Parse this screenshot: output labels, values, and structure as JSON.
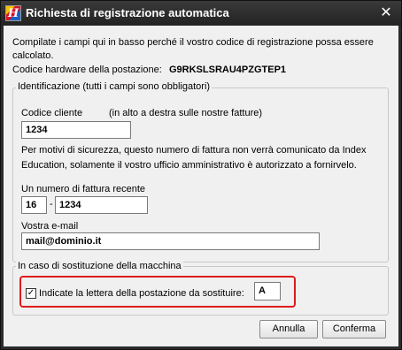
{
  "window": {
    "title": "Richiesta di registrazione automatica",
    "close_glyph": "✕",
    "app_icon_letter": "H"
  },
  "intro": {
    "text": "Compilate i campi qui in basso perché il vostro codice di registrazione possa essere calcolato.",
    "hardware_label": "Codice hardware della postazione:",
    "hardware_code": "G9RKSLSRAU4PZGTEP1"
  },
  "identification": {
    "legend": "Identificazione (tutti i campi sono obbligatori)",
    "client_code_label": "Codice cliente",
    "client_code_hint": "(in alto a destra sulle nostre fatture)",
    "client_code_value": "1234",
    "privacy_note": "Per motivi di sicurezza, questo numero di fattura non verrà comunicato da Index Education, solamente il vostro ufficio amministrativo è autorizzato a fornirvelo.",
    "invoice_label": "Un numero di fattura recente",
    "invoice_part1": "16",
    "invoice_separator": "-",
    "invoice_part2": "1234",
    "email_label": "Vostra e-mail",
    "email_value": "mail@dominio.it"
  },
  "replacement": {
    "legend": "In caso di sostituzione della macchina",
    "checkbox_checked": true,
    "checkbox_glyph": "✓",
    "checkbox_label": "Indicate la lettera della postazione da sostituire:",
    "letter_value": "A"
  },
  "buttons": {
    "cancel": "Annulla",
    "confirm": "Conferma"
  },
  "colors": {
    "highlight": "#e01b1b",
    "titlebar": "#2b2b2b",
    "dialog_bg": "#f0f0f0"
  }
}
